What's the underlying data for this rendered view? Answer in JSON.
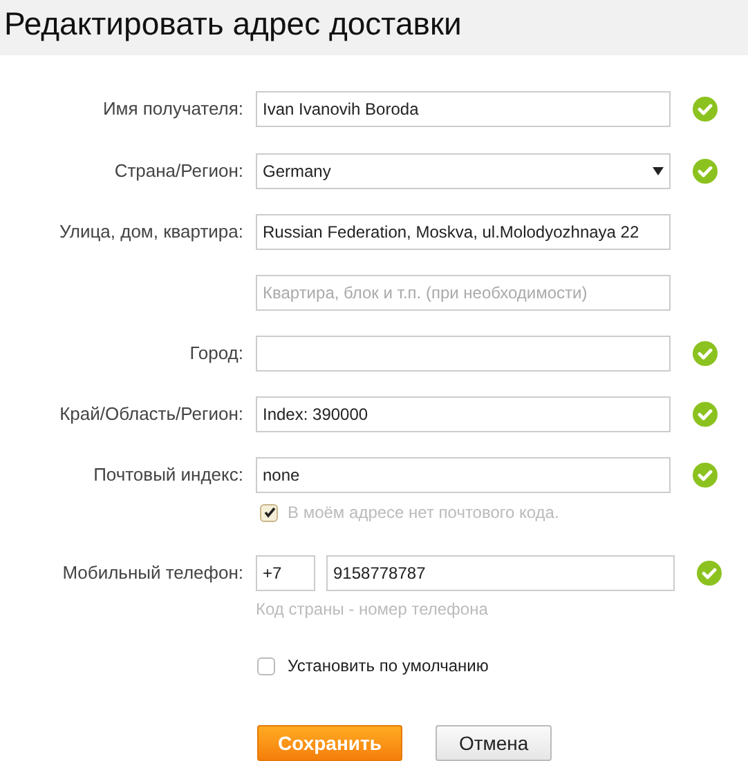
{
  "title": "Редактировать адрес доставки",
  "fields": [
    {
      "kind": "text",
      "label": "Имя получателя:",
      "value": "Ivan Ivanovih Boroda",
      "valid": true
    },
    {
      "kind": "select",
      "label": "Страна/Регион:",
      "value": "Germany",
      "valid": true
    },
    {
      "kind": "text",
      "label": "Улица, дом, квартира:",
      "value": "Russian Federation, Moskva, ul.Molodyozhnaya 22",
      "valid": false
    },
    {
      "kind": "text",
      "placeholder": "Квартира, блок и т.п. (при необходимости)",
      "valid": false
    },
    {
      "kind": "text",
      "label": "Город:",
      "valid": true
    },
    {
      "kind": "text",
      "label": "Край/Область/Регион:",
      "value": "Index: 390000",
      "valid": true
    },
    {
      "kind": "text",
      "label": "Почтовый индекс:",
      "value": "none",
      "valid": true,
      "option": {
        "label": "В моём адресе нет почтового кода.",
        "checked": true
      }
    },
    {
      "kind": "phone",
      "label": "Мобильный телефон:",
      "code": "+7",
      "value": "9158778787",
      "hint": "Код страны - номер телефона",
      "valid": true
    }
  ],
  "default_option": {
    "label": "Установить по умолчанию",
    "checked": false
  },
  "buttons": [
    {
      "kind": "primary",
      "label": "Сохранить"
    },
    {
      "kind": "secondary",
      "label": "Отмена"
    }
  ]
}
